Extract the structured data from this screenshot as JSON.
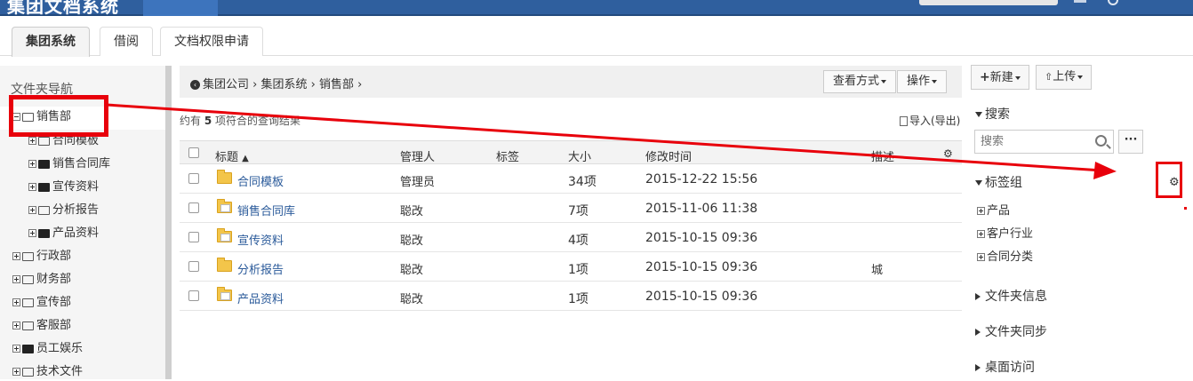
{
  "app": {
    "title": "集团文档系统"
  },
  "tabs": [
    {
      "label": "集团系统",
      "active": true
    },
    {
      "label": "借阅",
      "active": false
    },
    {
      "label": "文档权限申请",
      "active": false
    }
  ],
  "sidebar": {
    "title": "文件夹导航",
    "items": [
      {
        "label": "销售部",
        "level": 0,
        "expanded": true,
        "selected": true,
        "filled": false
      },
      {
        "label": "合同模板",
        "level": 1,
        "expanded": false,
        "filled": false
      },
      {
        "label": "销售合同库",
        "level": 1,
        "expanded": false,
        "filled": true
      },
      {
        "label": "宣传资料",
        "level": 1,
        "expanded": false,
        "filled": true
      },
      {
        "label": "分析报告",
        "level": 1,
        "expanded": false,
        "filled": false
      },
      {
        "label": "产品资料",
        "level": 1,
        "expanded": false,
        "filled": true
      },
      {
        "label": "行政部",
        "level": 0,
        "expanded": false,
        "filled": false
      },
      {
        "label": "财务部",
        "level": 0,
        "expanded": false,
        "filled": false
      },
      {
        "label": "宣传部",
        "level": 0,
        "expanded": false,
        "filled": false
      },
      {
        "label": "客服部",
        "level": 0,
        "expanded": false,
        "filled": false
      },
      {
        "label": "员工娱乐",
        "level": 0,
        "expanded": false,
        "filled": true
      },
      {
        "label": "技术文件",
        "level": 0,
        "expanded": false,
        "filled": false
      }
    ]
  },
  "breadcrumb": {
    "items": [
      "集团公司",
      "集团系统",
      "销售部"
    ],
    "sep": "›"
  },
  "toolbar": {
    "view_label": "查看方式",
    "ops_label": "操作"
  },
  "result": {
    "prefix": "约有",
    "count": "5",
    "suffix": "项符合的查询结果"
  },
  "import_label": "导入(导出)",
  "table": {
    "columns": {
      "title": "标题",
      "manager": "管理人",
      "tags": "标签",
      "size": "大小",
      "modified": "修改时间",
      "desc": "描述"
    },
    "sort_indicator": "▲",
    "rows": [
      {
        "title": "合同模板",
        "manager": "管理员",
        "tags": "",
        "size": "34项",
        "modified": "2015-12-22 15:56",
        "desc": "",
        "doc": false
      },
      {
        "title": "销售合同库",
        "manager": "聪改",
        "tags": "",
        "size": "7项",
        "modified": "2015-11-06 11:38",
        "desc": "",
        "doc": true
      },
      {
        "title": "宣传资料",
        "manager": "聪改",
        "tags": "",
        "size": "4项",
        "modified": "2015-10-15 09:36",
        "desc": "",
        "doc": true
      },
      {
        "title": "分析报告",
        "manager": "聪改",
        "tags": "",
        "size": "1项",
        "modified": "2015-10-15 09:36",
        "desc": "城",
        "doc": false
      },
      {
        "title": "产品资料",
        "manager": "聪改",
        "tags": "",
        "size": "1项",
        "modified": "2015-10-15 09:36",
        "desc": "",
        "doc": true
      }
    ]
  },
  "right": {
    "new_label": "新建",
    "upload_label": "上传",
    "search_section": "搜索",
    "search_placeholder": "搜索",
    "more_label": "···",
    "taggroup_section": "标签组",
    "tags": [
      "产品",
      "客户行业",
      "合同分类"
    ],
    "sections": [
      "文件夹信息",
      "文件夹同步",
      "桌面访问"
    ]
  },
  "colors": {
    "topbar": "#2f5f9e",
    "highlight": "#e8000b",
    "link": "#2a5a9a"
  }
}
